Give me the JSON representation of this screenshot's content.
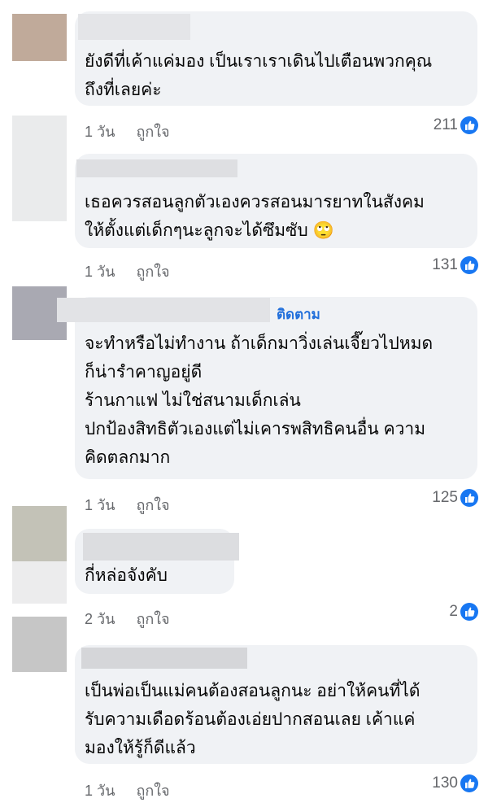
{
  "comments": [
    {
      "text": "ยังดีที่เค้าแค่มอง เป็นเราเราเดินไปเตือนพวกคุณ\nถึงที่เลยค่ะ",
      "time": "1 วัน",
      "like_label": "ถูกใจ",
      "reactions": "211"
    },
    {
      "text": "เธอควรสอนลูกตัวเองควรสอนมารยาทในสังคม\nให้ตั้งแต่เด็กๆนะลูกจะได้ซึมซับ",
      "emoji": "🙄",
      "time": "1 วัน",
      "like_label": "ถูกใจ",
      "reactions": "131"
    },
    {
      "follow": "ติดตาม",
      "text": "จะทำหรือไม่ทำงาน ถ้าเด็กมาวิ่งเล่นเจี๊ยวไปหมด\nก็น่ารำคาญอยู่ดี\nร้านกาแฟ ไม่ใช่สนามเด็กเล่น\nปกป้องสิทธิตัวเองแต่ไม่เคารพสิทธิคนอื่น ความ\nคิดตลกมาก",
      "time": "1 วัน",
      "like_label": "ถูกใจ",
      "reactions": "125"
    },
    {
      "text": "กี่หล่อจังคับ",
      "time": "2 วัน",
      "like_label": "ถูกใจ",
      "reactions": "2"
    },
    {
      "text": "เป็นพ่อเป็นแม่คนต้องสอนลูกนะ อย่าให้คนที่ได้\nรับความเดือดร้อนต้องเอ่ยปากสอนเลย เค้าแค่\nมองให้รู้ก็ดีแล้ว",
      "time": "1 วัน",
      "like_label": "ถูกใจ",
      "reactions": "130"
    }
  ],
  "colors": {
    "bubble": "#f0f2f5",
    "text": "#050505",
    "meta": "#65676b",
    "follow": "#216fdb",
    "like_icon": "#1877f2"
  },
  "icons": {
    "like": "thumbs-up-icon"
  }
}
